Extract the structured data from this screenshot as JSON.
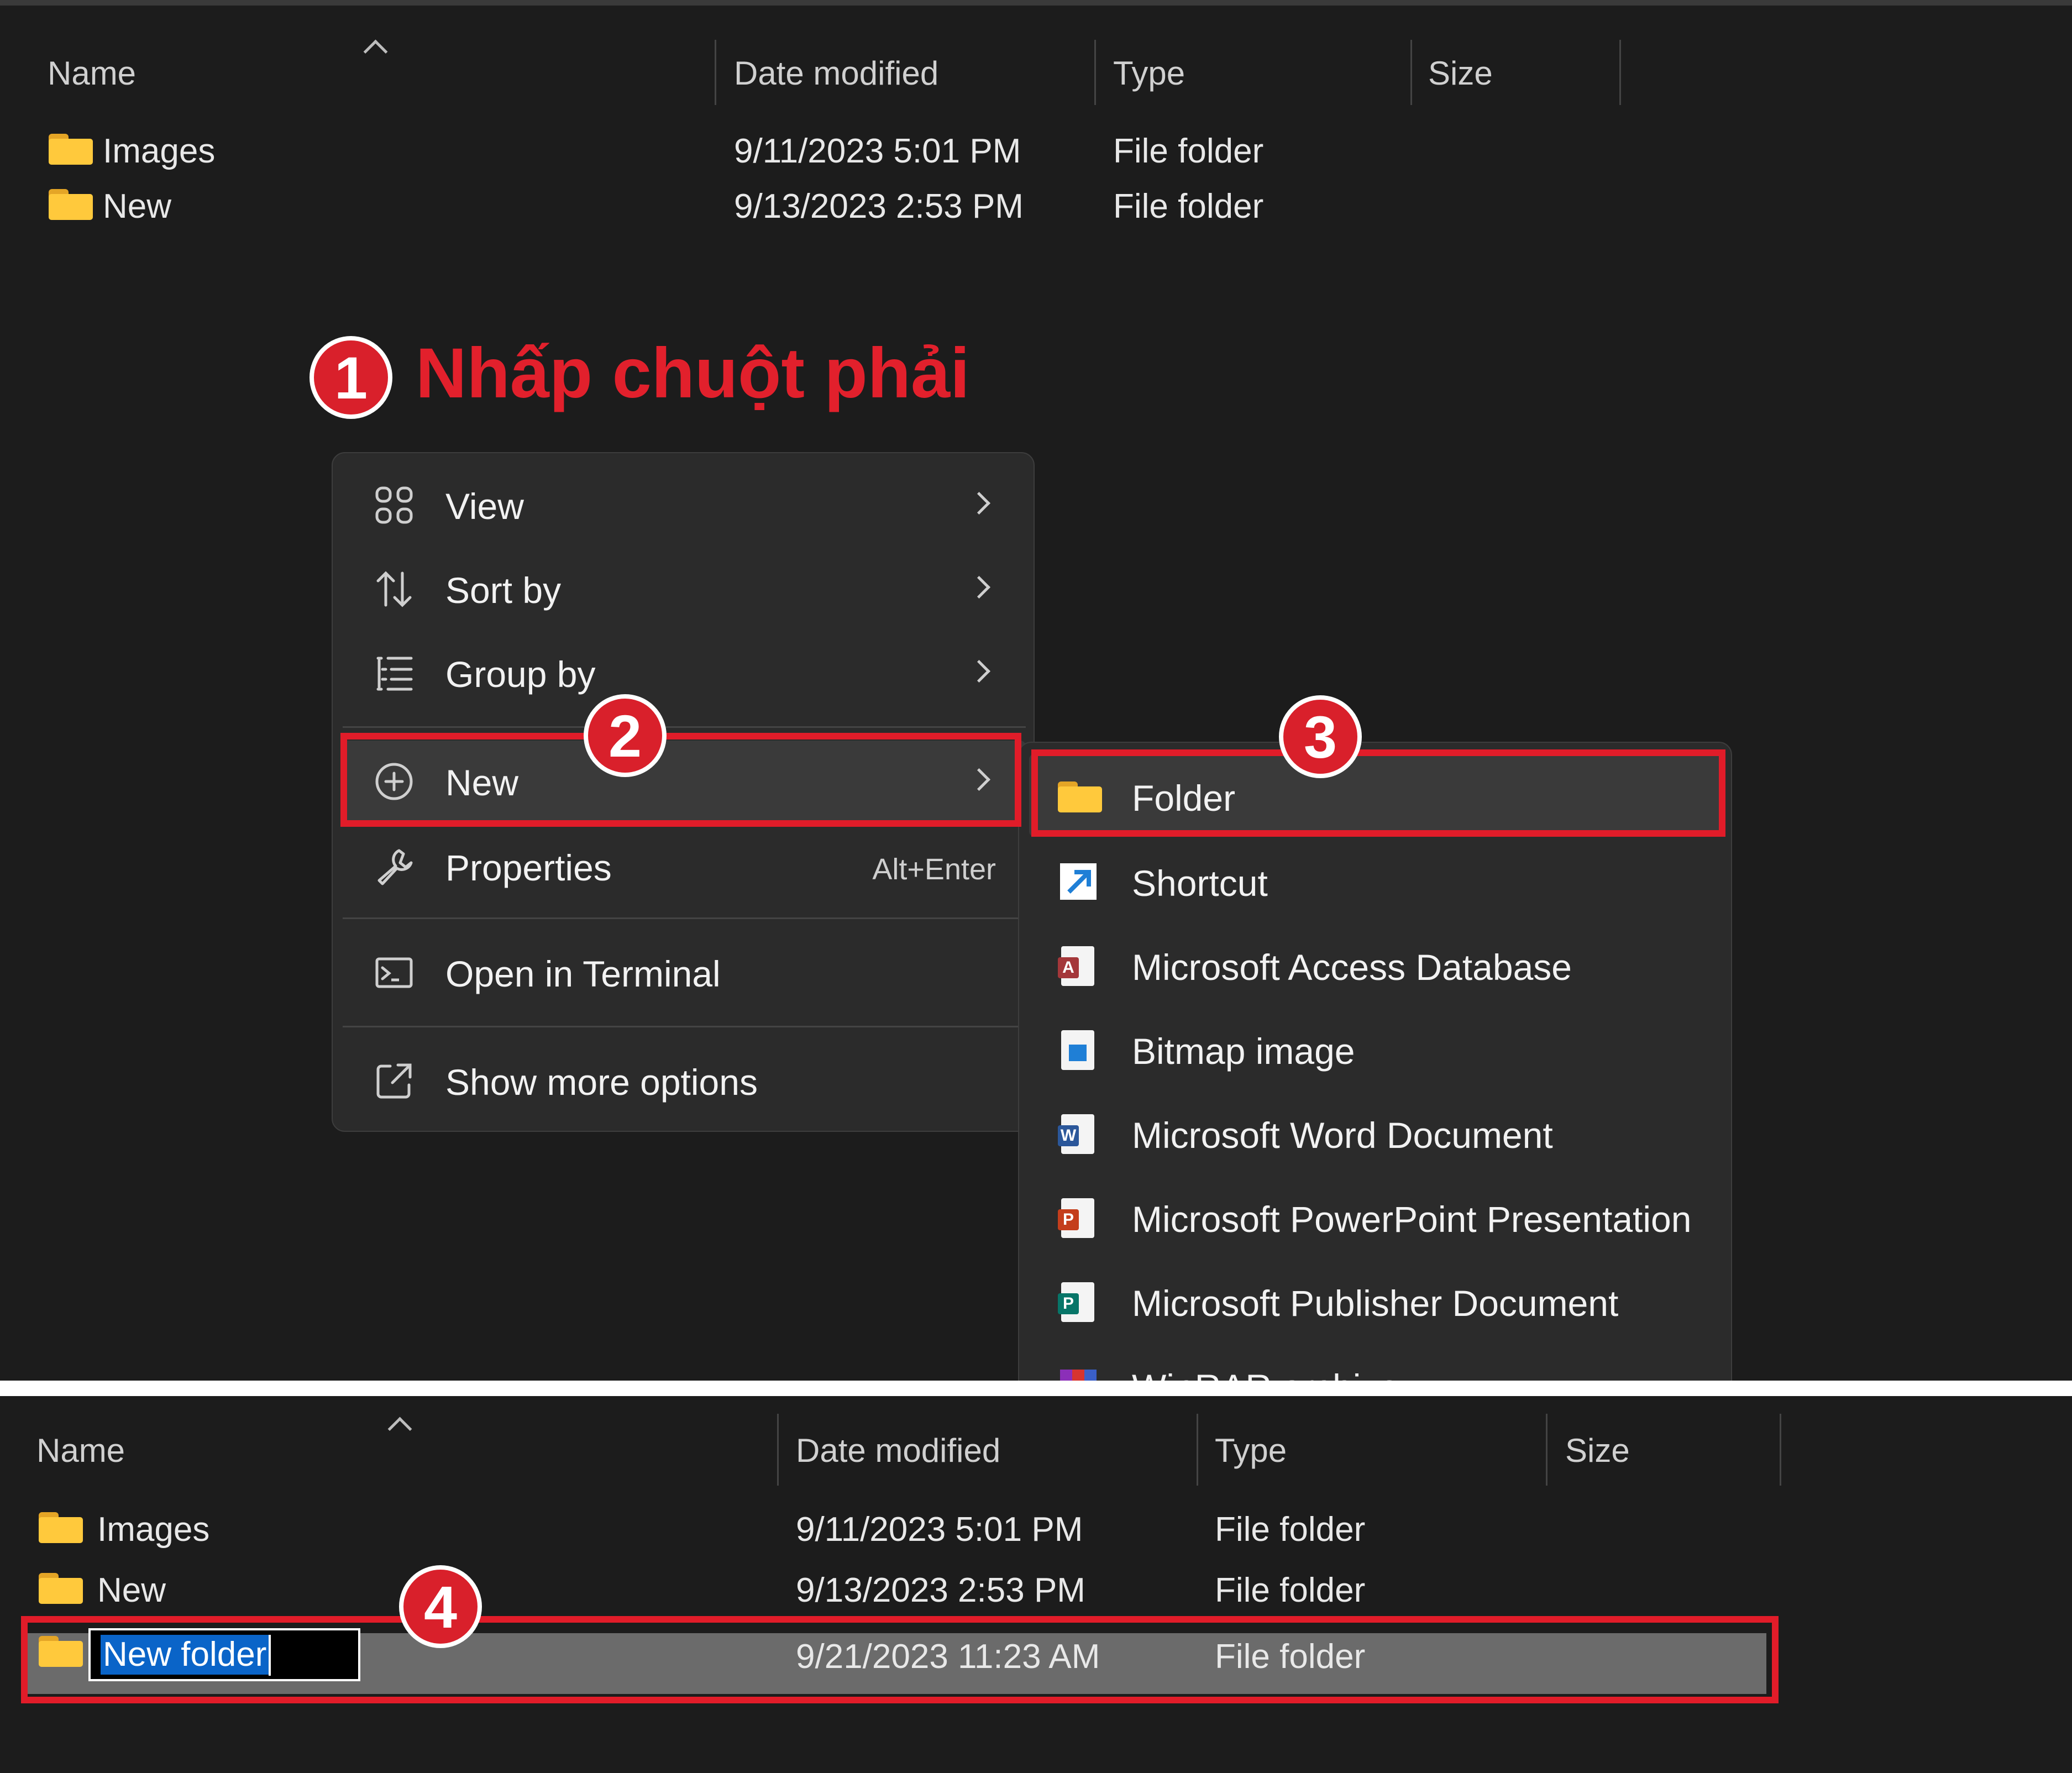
{
  "columns": {
    "name": "Name",
    "date": "Date modified",
    "type": "Type",
    "size": "Size"
  },
  "top_rows": [
    {
      "name": "Images",
      "date": "9/11/2023 5:01 PM",
      "type": "File folder"
    },
    {
      "name": "New",
      "date": "9/13/2023 2:53 PM",
      "type": "File folder"
    }
  ],
  "callouts": {
    "step1": "1",
    "step1_text": "Nhấp chuột phải",
    "step2": "2",
    "step3": "3",
    "step4": "4"
  },
  "context_menu": {
    "view": "View",
    "sort_by": "Sort by",
    "group_by": "Group by",
    "new": "New",
    "properties": "Properties",
    "properties_shortcut": "Alt+Enter",
    "open_terminal": "Open in Terminal",
    "show_more": "Show more options"
  },
  "submenu": [
    {
      "label": "Folder",
      "icon": "folder-icon"
    },
    {
      "label": "Shortcut",
      "icon": "shortcut-icon"
    },
    {
      "label": "Microsoft Access Database",
      "icon": "access-icon"
    },
    {
      "label": "Bitmap image",
      "icon": "bitmap-icon"
    },
    {
      "label": "Microsoft Word Document",
      "icon": "word-icon"
    },
    {
      "label": "Microsoft PowerPoint Presentation",
      "icon": "powerpoint-icon"
    },
    {
      "label": "Microsoft Publisher Document",
      "icon": "publisher-icon"
    },
    {
      "label": "WinRAR archive",
      "icon": "winrar-icon"
    }
  ],
  "bottom_rows": [
    {
      "name": "Images",
      "date": "9/11/2023 5:01 PM",
      "type": "File folder"
    },
    {
      "name": "New",
      "date": "9/13/2023 2:53 PM",
      "type": "File folder"
    },
    {
      "name": "New folder",
      "date": "9/21/2023 11:23 AM",
      "type": "File folder"
    }
  ],
  "colors": {
    "background": "#1c1c1c",
    "menu": "#2b2b2b",
    "highlight": "#e11c29",
    "selection": "#0a64c8",
    "folder": "#ffc93c"
  }
}
